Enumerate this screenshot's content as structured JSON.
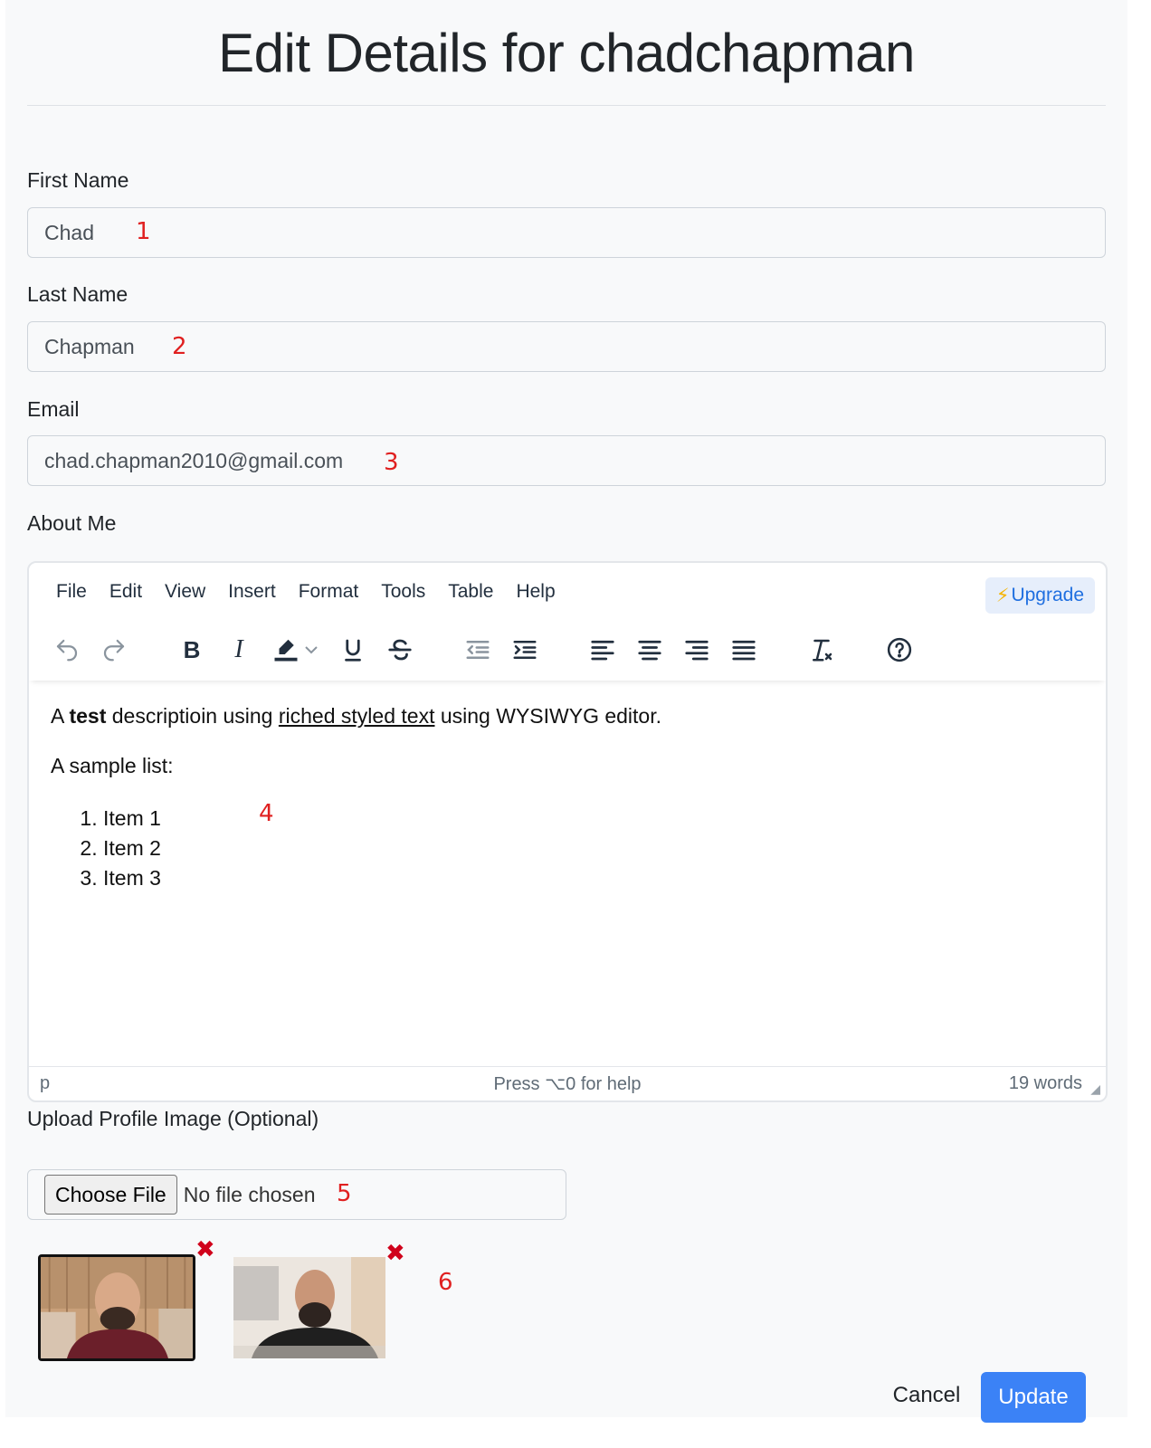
{
  "page": {
    "title": "Edit Details for chadchapman"
  },
  "form": {
    "first_name": {
      "label": "First Name",
      "value": "Chad",
      "annotation": "1"
    },
    "last_name": {
      "label": "Last Name",
      "value": "Chapman",
      "annotation": "2"
    },
    "email": {
      "label": "Email",
      "value": "chad.chapman2010@gmail.com",
      "annotation": "3"
    },
    "about": {
      "label": "About Me",
      "annotation": "4"
    },
    "upload": {
      "label": "Upload Profile Image (Optional)",
      "button": "Choose File",
      "status": "No file chosen",
      "annotation": "5"
    },
    "images": {
      "annotation": "6",
      "remove_glyph": "✖"
    }
  },
  "editor": {
    "menu": [
      "File",
      "Edit",
      "View",
      "Insert",
      "Format",
      "Tools",
      "Table",
      "Help"
    ],
    "upgrade_bolt": "⚡",
    "upgrade_label": "Upgrade",
    "toolbar_icons": [
      "undo-icon",
      "redo-icon",
      "bold-icon",
      "italic-icon",
      "highlight-icon",
      "chevron-down-icon",
      "underline-icon",
      "strikethrough-icon",
      "outdent-icon",
      "indent-icon",
      "align-left-icon",
      "align-center-icon",
      "align-right-icon",
      "justify-icon",
      "clear-formatting-icon",
      "help-icon"
    ],
    "content": {
      "p1_before": "A ",
      "p1_bold": "test",
      "p1_mid": " descriptioin using ",
      "p1_underline": "riched styled text",
      "p1_after": " using WYSIWYG editor.",
      "p2": "A sample list:",
      "list": [
        "Item 1",
        "Item 2",
        "Item 3"
      ]
    },
    "status_path": "p",
    "status_help": "Press ⌥0 for help",
    "status_words": "19 words"
  },
  "actions": {
    "cancel": "Cancel",
    "update": "Update"
  },
  "colors": {
    "primary": "#3b82f6",
    "annotation": "#e02020",
    "remove": "#d0021b"
  }
}
